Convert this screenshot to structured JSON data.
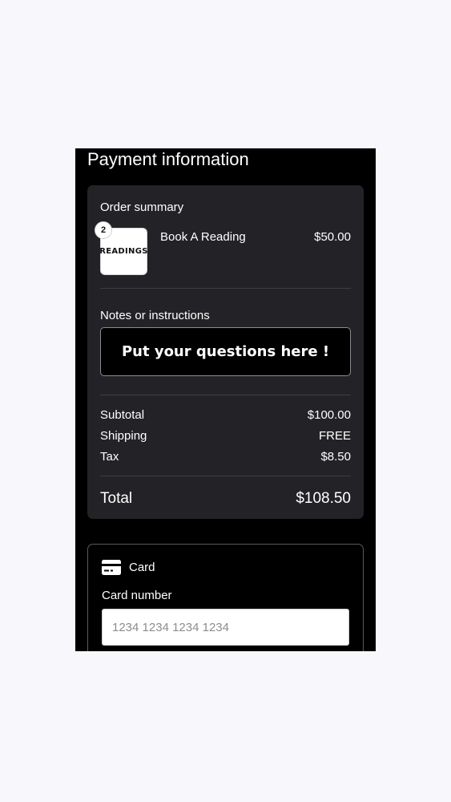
{
  "page": {
    "title": "Payment information"
  },
  "order_summary": {
    "label": "Order summary",
    "item": {
      "thumbnail_text": "READINGS",
      "quantity": "2",
      "name": "Book A Reading",
      "price": "$50.00"
    }
  },
  "notes": {
    "label": "Notes or instructions",
    "box_text": "Put your questions here !"
  },
  "totals": {
    "subtotal_label": "Subtotal",
    "subtotal_value": "$100.00",
    "shipping_label": "Shipping",
    "shipping_value": "FREE",
    "tax_label": "Tax",
    "tax_value": "$8.50",
    "total_label": "Total",
    "total_value": "$108.50"
  },
  "payment": {
    "method_icon": "credit-card-icon",
    "method_label": "Card",
    "card_number_label": "Card number",
    "card_number_value": "",
    "card_number_placeholder": "1234 1234 1234 1234"
  },
  "colors": {
    "page_background": "#f8f8fc",
    "screen_background": "#000000",
    "card_background": "#232327",
    "text": "#ffffff"
  }
}
